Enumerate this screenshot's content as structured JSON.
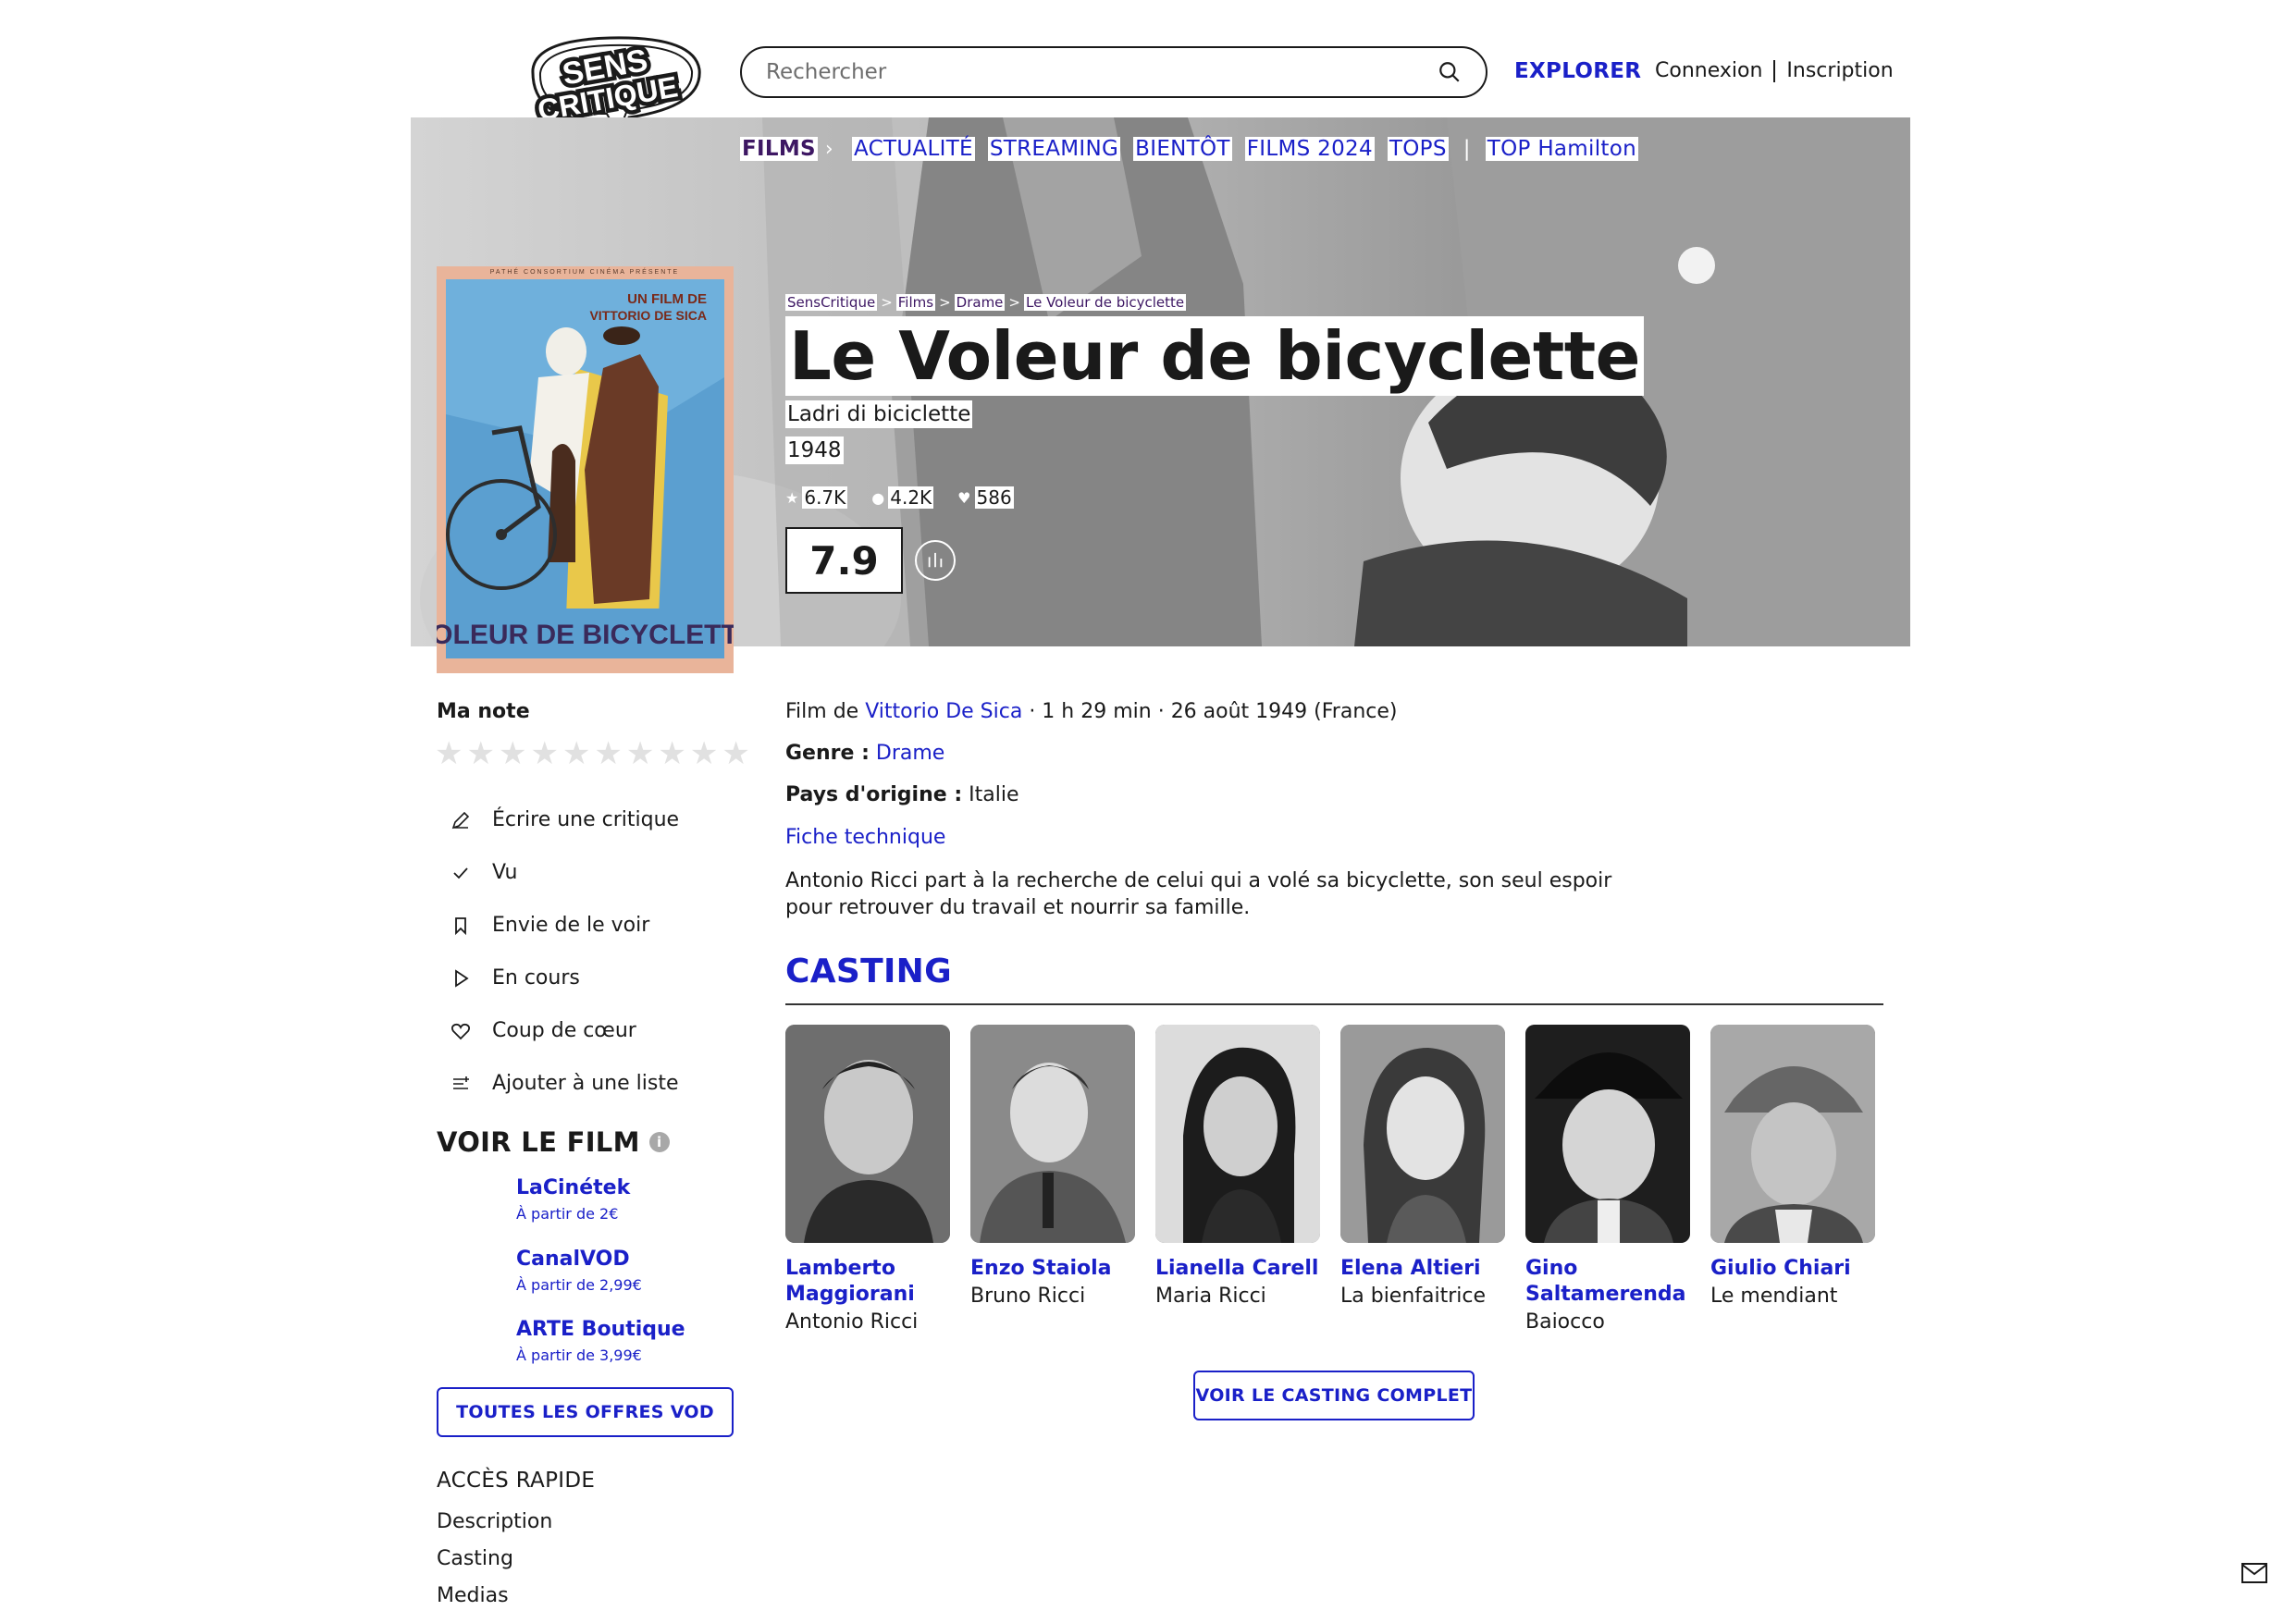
{
  "header": {
    "logo_line1": "SENS",
    "logo_line2": "CRITIQUE",
    "search_placeholder": "Rechercher",
    "explorer": "EXPLORER",
    "connexion": "Connexion",
    "inscription": "Inscription"
  },
  "nav": {
    "films": "FILMS",
    "items": [
      "ACTUALITÉ",
      "STREAMING",
      "BIENTÔT",
      "FILMS 2024",
      "TOPS"
    ],
    "extra": "TOP Hamilton"
  },
  "breadcrumb": [
    "SensCritique",
    "Films",
    "Drame",
    "Le Voleur de bicyclette"
  ],
  "movie": {
    "title": "Le Voleur de bicyclette",
    "original_title": "Ladri di biciclette",
    "year": "1948",
    "stats": [
      "6.7K",
      "4.2K",
      "586"
    ],
    "score": "7.9",
    "poster_line1": "UN FILM DE",
    "poster_line2": "VITTORIO DE SICA",
    "poster_title": "VOLEUR DE BICYCLETTE",
    "poster_top": "PATHÉ CONSORTIUM CINÉMA PRÉSENTE"
  },
  "sidebar": {
    "ma_note": "Ma note",
    "actions": [
      "Écrire une critique",
      "Vu",
      "Envie de le voir",
      "En cours",
      "Coup de cœur",
      "Ajouter à une liste"
    ],
    "voir_title": "VOIR LE FILM",
    "vod": [
      {
        "name": "LaCinétek",
        "price": "À partir de 2€"
      },
      {
        "name": "CanalVOD",
        "price": "À partir de 2,99€"
      },
      {
        "name": "ARTE Boutique",
        "price": "À partir de 3,99€"
      }
    ],
    "vod_button": "TOUTES LES OFFRES VOD",
    "acces_title": "ACCÈS RAPIDE",
    "quick_links": [
      "Description",
      "Casting",
      "Medias"
    ]
  },
  "details": {
    "film_de": "Film de",
    "director": "Vittorio De Sica",
    "meta": " · 1 h 29 min · 26 août 1949 (France)",
    "genre_label": "Genre :",
    "genre": "Drame",
    "pays_label": "Pays d'origine :",
    "pays": "Italie",
    "fiche": "Fiche technique",
    "synopsis": "Antonio Ricci part à la recherche de celui qui a volé sa bicyclette, son seul espoir pour retrouver du travail et nourrir sa famille."
  },
  "casting": {
    "title": "CASTING",
    "actors": [
      {
        "name": "Lamberto Maggiorani",
        "role": "Antonio Ricci"
      },
      {
        "name": "Enzo Staiola",
        "role": "Bruno Ricci"
      },
      {
        "name": "Lianella Carell",
        "role": "Maria Ricci"
      },
      {
        "name": "Elena Altieri",
        "role": "La bienfaitrice"
      },
      {
        "name": "Gino Saltamerenda",
        "role": "Baiocco"
      },
      {
        "name": "Giulio Chiari",
        "role": "Le mendiant"
      }
    ],
    "button": "VOIR LE CASTING COMPLET"
  },
  "colors": {
    "accent": "#1a20c8",
    "nav_active": "#3d1763",
    "text": "#1a1a1a"
  }
}
